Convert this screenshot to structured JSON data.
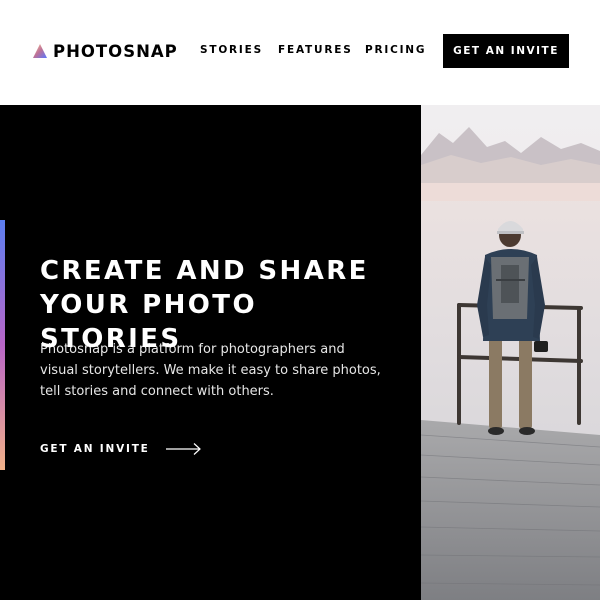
{
  "header": {
    "brand": "PHOTOSNAP",
    "nav": {
      "stories": "STORIES",
      "features": "FEATURES",
      "pricing": "PRICING"
    },
    "cta_label": "GET AN INVITE"
  },
  "hero": {
    "title_line1": "CREATE AND SHARE",
    "title_line2": "YOUR PHOTO STORIES",
    "description": "Photosnap is a platform for photographers and visual storytellers. We make it easy to share photos, tell stories and connect with others.",
    "cta_label": "GET AN INVITE"
  },
  "icons": {
    "logo": "triangle-gradient-logo-icon",
    "cta": "arrow-right-icon"
  },
  "colors": {
    "background": "#ffffff",
    "hero_background": "#000000",
    "text_light": "#ffffff",
    "text_dark": "#000000",
    "accent_gradient": [
      "#5c7ef0",
      "#b866c7",
      "#f2b188"
    ]
  }
}
